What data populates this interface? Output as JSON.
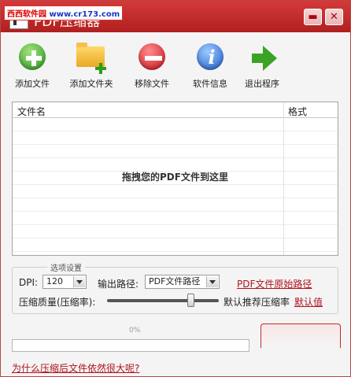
{
  "watermark": {
    "site": "西西软件园",
    "url": "www.cr173.com"
  },
  "window": {
    "title": "PDF压缩器",
    "min_label": "▬",
    "close_label": "✕"
  },
  "toolbar": {
    "add_file": "添加文件",
    "add_folder": "添加文件夹",
    "remove_file": "移除文件",
    "software_info": "软件信息",
    "exit": "退出程序"
  },
  "filelist": {
    "col_name": "文件名",
    "col_format": "格式",
    "drop_hint": "拖拽您的PDF文件到这里"
  },
  "options": {
    "legend": "选项设置",
    "dpi_label": "DPI:",
    "dpi_value": "120",
    "output_label": "输出路径:",
    "output_value": "PDF文件路径",
    "original_path_link": "PDF文件原始路径",
    "quality_label": "压缩质量(压缩率):",
    "quality_level": 0.77,
    "recommended_label": "默认推荐压缩率",
    "default_link": "默认值"
  },
  "progress": {
    "percent_text": "0%",
    "value": 0
  },
  "help_link": "为什么压缩后文件依然很大呢?",
  "colors": {
    "title_bar": "#c42a2a",
    "link": "#b0131c"
  }
}
